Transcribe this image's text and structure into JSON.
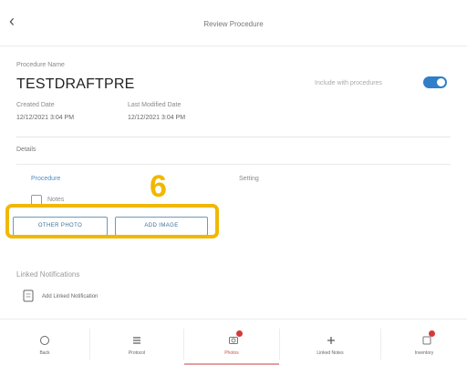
{
  "header": {
    "back_icon": "chevron-left-icon",
    "title": "Review Procedure"
  },
  "procedure": {
    "name_label": "Procedure Name",
    "name": "TESTDRAFTPRE",
    "created_label": "Created Date",
    "created_value": "12/12/2021 3:04 PM",
    "modified_label": "Last Modified Date",
    "modified_value": "12/12/2021 3:04 PM",
    "toggle_label": "Include with procedures",
    "toggle_on": true,
    "toggle_color": "#2f7fc9"
  },
  "details": {
    "section_label": "Details",
    "col1_header": "Procedure",
    "col2_header": "Setting",
    "checkbox_label": "Notes"
  },
  "buttons": {
    "photo_label": "OTHER PHOTO",
    "image_label": "ADD IMAGE"
  },
  "annotation": {
    "step_number": "6",
    "color": "#f1b800"
  },
  "notifications": {
    "label": "Linked Notifications",
    "item_label": "Add Linked Notification",
    "item_icon": "document-icon"
  },
  "bottom_nav": {
    "items": [
      {
        "label": "Back",
        "icon": "home-icon",
        "badge": false
      },
      {
        "label": "Protocol",
        "icon": "list-icon",
        "badge": false
      },
      {
        "label": "Photos",
        "icon": "camera-icon",
        "badge": true
      },
      {
        "label": "Linked Notes",
        "icon": "plus-icon",
        "badge": false
      },
      {
        "label": "Inventory",
        "icon": "box-icon",
        "badge": true
      }
    ],
    "active_index": 2,
    "badge_color": "#d43a3a"
  }
}
